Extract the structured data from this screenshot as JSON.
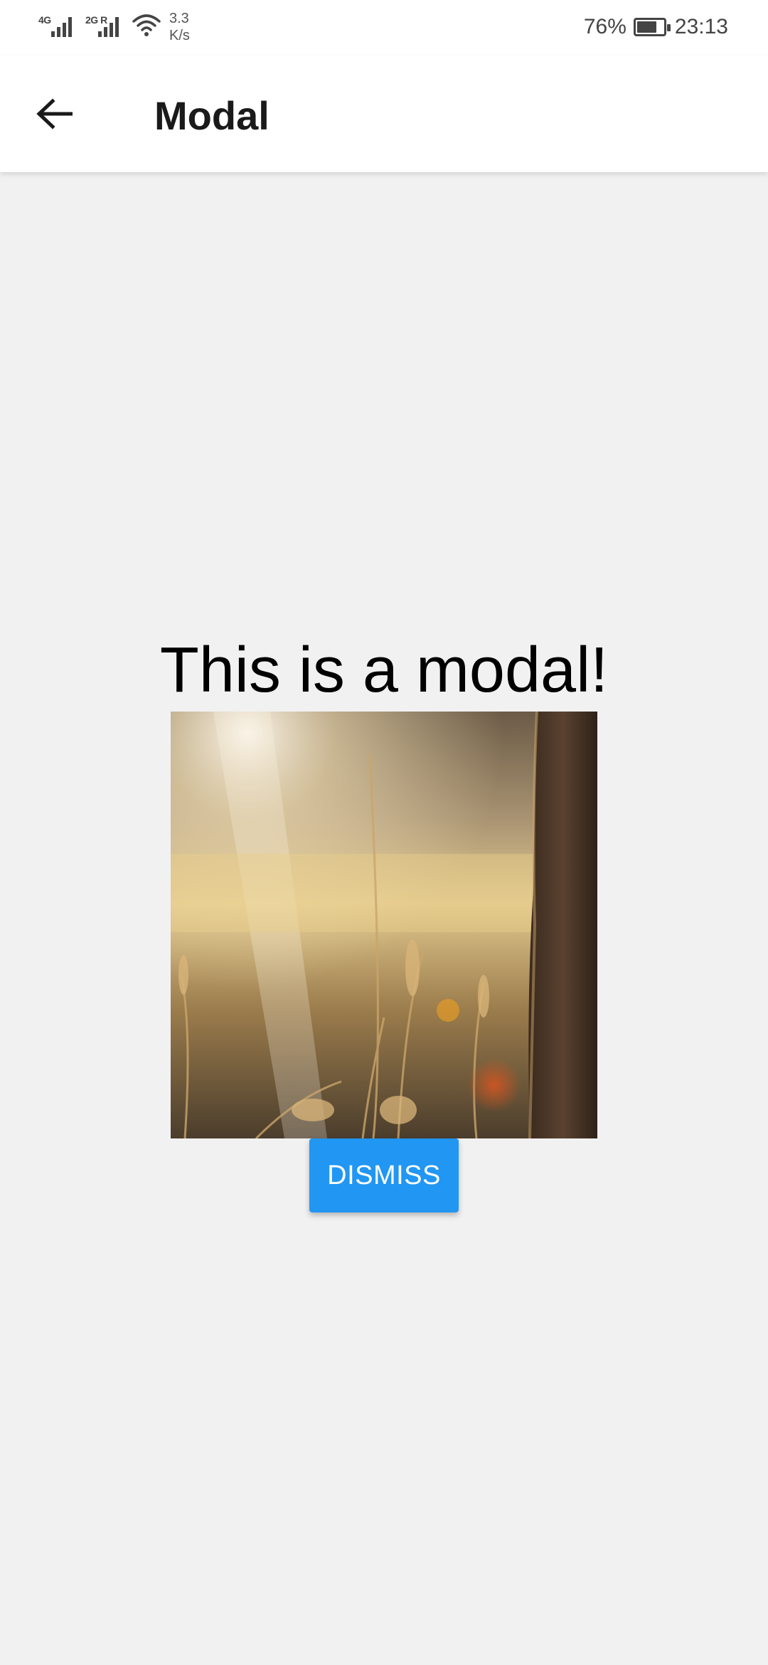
{
  "status_bar": {
    "network_1": "4G",
    "network_2": "2G R",
    "speed_value": "3.3",
    "speed_unit": "K/s",
    "battery_percent": "76%",
    "battery_level": 0.76,
    "time": "23:13",
    "icons": [
      "signal-icon",
      "signal-icon",
      "wifi-icon",
      "battery-icon"
    ]
  },
  "app_bar": {
    "back_icon": "arrow-left-icon",
    "title": "Modal"
  },
  "modal": {
    "heading": "This is a modal!",
    "image_description_icon": "photo",
    "dismiss_label": "DISMISS"
  },
  "colors": {
    "background": "#f1f1f2",
    "app_bar": "#ffffff",
    "accent": "#2196f3"
  }
}
